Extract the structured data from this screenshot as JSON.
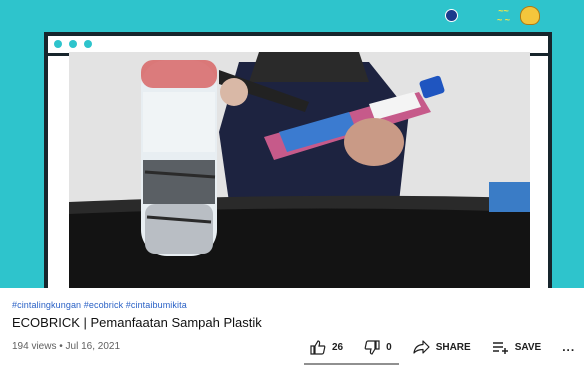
{
  "video": {
    "hashtags": "#cintalingkungan #ecobrick #cintaibumikita",
    "title": "ECOBRICK | Pemanfaatan Sampah Plastik",
    "views_date": "194 views • Jul 16, 2021"
  },
  "actions": {
    "like_count": "26",
    "dislike_count": "0",
    "share_label": "SHARE",
    "save_label": "SAVE",
    "more_label": "..."
  },
  "icons": {
    "like": "thumbs-up-icon",
    "dislike": "thumbs-down-icon",
    "share": "share-arrow-icon",
    "save": "playlist-add-icon",
    "more": "more-horizontal-icon"
  },
  "colors": {
    "banner_teal": "#2ec4cc",
    "hashtag_blue": "#2b62c6",
    "frame_dark": "#17252c"
  }
}
